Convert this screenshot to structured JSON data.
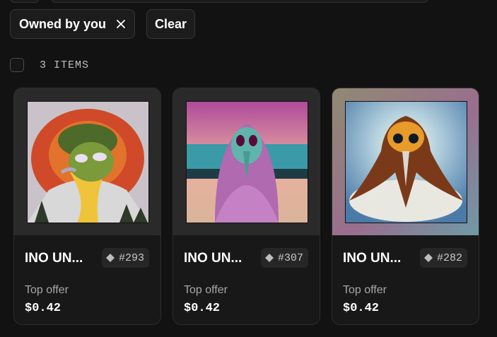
{
  "filters": {
    "owned_chip_label": "Owned by you",
    "clear_label": "Clear"
  },
  "items": {
    "count_label": "3 ITEMS"
  },
  "cards": [
    {
      "name": "INO UN...",
      "id": "#293",
      "offer_label": "Top offer",
      "offer_value": "$0.42"
    },
    {
      "name": "INO UN...",
      "id": "#307",
      "offer_label": "Top offer",
      "offer_value": "$0.42"
    },
    {
      "name": "INO UN...",
      "id": "#282",
      "offer_label": "Top offer",
      "offer_value": "$0.42"
    }
  ],
  "colors": {
    "background": "#121212",
    "card": "#181818",
    "chip": "#1c1c1c",
    "muted_text": "#a8a8a8"
  },
  "icons": {
    "chip_remove": "close-icon",
    "id_badge": "diamond-icon"
  }
}
